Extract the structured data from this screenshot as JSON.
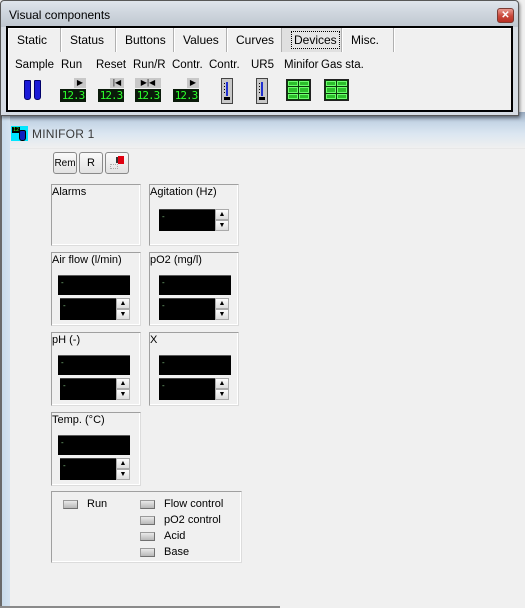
{
  "visual_components": {
    "title": "Visual components",
    "close_icon": "close-icon",
    "tabs": [
      {
        "label": "Static",
        "active": false
      },
      {
        "label": "Status",
        "active": false
      },
      {
        "label": "Buttons",
        "active": false
      },
      {
        "label": "Values",
        "active": false
      },
      {
        "label": "Curves",
        "active": false
      },
      {
        "label": "Devices",
        "active": true
      },
      {
        "label": "Misc.",
        "active": false
      }
    ],
    "components": [
      {
        "label": "Sample",
        "icon": "sample-vials-icon"
      },
      {
        "label": "Run",
        "icon": "run-lcd-icon",
        "display": "12.3",
        "glyph": "▶"
      },
      {
        "label": "Reset",
        "icon": "reset-lcd-icon",
        "display": "12.3",
        "glyph": "|◀"
      },
      {
        "label": "Run/R",
        "icon": "run-reset-lcd-icon",
        "display": "12.3",
        "glyph": "▶|◀"
      },
      {
        "label": "Contr.",
        "icon": "controller-lcd-icon",
        "display": "12.3",
        "glyph": "▶"
      },
      {
        "label": "Contr.",
        "icon": "controller-gauge-icon"
      },
      {
        "label": "UR5",
        "icon": "ur5-gauge-icon"
      },
      {
        "label": "Minifor",
        "icon": "minifor-grid-icon"
      },
      {
        "label": "Gas sta.",
        "icon": "gas-station-grid-icon"
      }
    ]
  },
  "minifor": {
    "title": "MINIFOR 1",
    "buttons": {
      "rem": "Rem",
      "r": "R"
    },
    "groups": {
      "alarms": {
        "label": "Alarms"
      },
      "agitation": {
        "label": "Agitation (Hz)",
        "setpoint": "-"
      },
      "air_flow": {
        "label": "Air flow (l/min)",
        "value": "-",
        "setpoint": "-"
      },
      "po2": {
        "label": "pO2 (mg/l)",
        "value": "-",
        "setpoint": "-"
      },
      "ph": {
        "label": "pH (-)",
        "value": "-",
        "setpoint": "-"
      },
      "x": {
        "label": "X",
        "value": "-",
        "setpoint": "-"
      },
      "temp": {
        "label": "Temp. (°C)",
        "value": "-",
        "setpoint": "-"
      }
    },
    "status": {
      "run": "Run",
      "flow_control": "Flow control",
      "po2_control": "pO2 control",
      "acid": "Acid",
      "base": "Base"
    },
    "spin_up": "▲",
    "spin_down": "▼"
  }
}
